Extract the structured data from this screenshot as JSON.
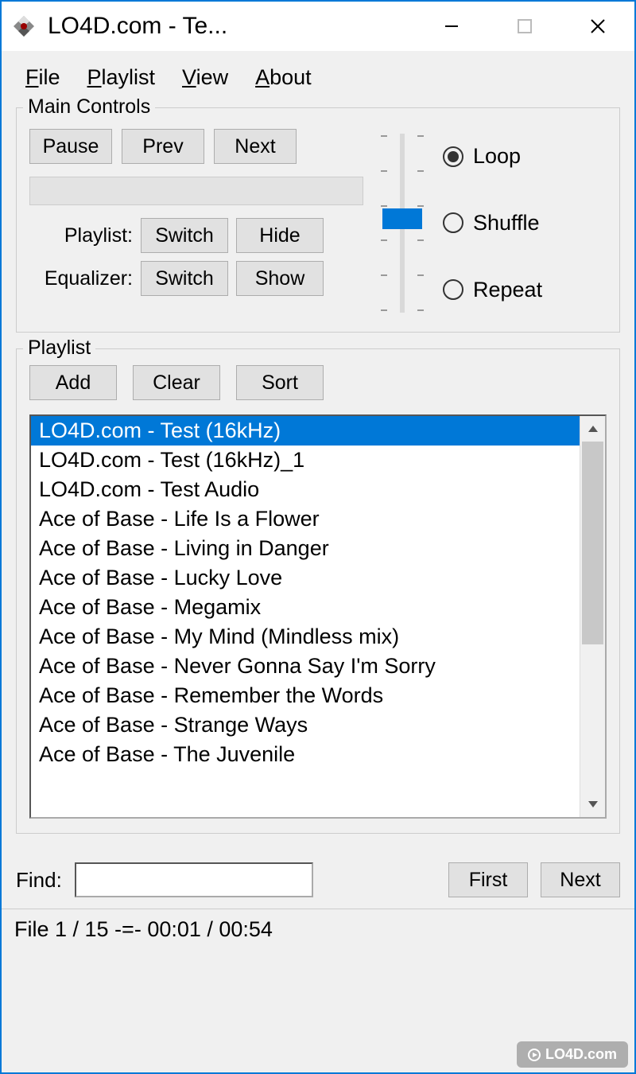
{
  "titlebar": {
    "title": "LO4D.com - Te..."
  },
  "menu": {
    "file": "File",
    "playlist": "Playlist",
    "view": "View",
    "about": "About"
  },
  "main_controls": {
    "legend": "Main Controls",
    "pause": "Pause",
    "prev": "Prev",
    "next": "Next",
    "playlist_label": "Playlist:",
    "playlist_switch": "Switch",
    "playlist_hide": "Hide",
    "equalizer_label": "Equalizer:",
    "equalizer_switch": "Switch",
    "equalizer_show": "Show"
  },
  "playback_mode": {
    "loop": "Loop",
    "shuffle": "Shuffle",
    "repeat": "Repeat",
    "selected": "loop"
  },
  "playlist_panel": {
    "legend": "Playlist",
    "add": "Add",
    "clear": "Clear",
    "sort": "Sort",
    "items": [
      "LO4D.com - Test (16kHz)",
      "LO4D.com - Test (16kHz)_1",
      "LO4D.com - Test Audio",
      "Ace of Base - Life Is a Flower",
      "Ace of Base - Living in Danger",
      "Ace of Base - Lucky Love",
      "Ace of Base - Megamix",
      "Ace of Base - My Mind (Mindless mix)",
      "Ace of Base - Never Gonna Say I'm Sorry",
      "Ace of Base - Remember the Words",
      "Ace of Base - Strange Ways",
      "Ace of Base - The Juvenile"
    ],
    "selected_index": 0
  },
  "find": {
    "label": "Find:",
    "value": "",
    "first": "First",
    "next": "Next"
  },
  "status": "File 1 / 15  -=- 00:01 / 00:54",
  "watermark": "LO4D.com"
}
